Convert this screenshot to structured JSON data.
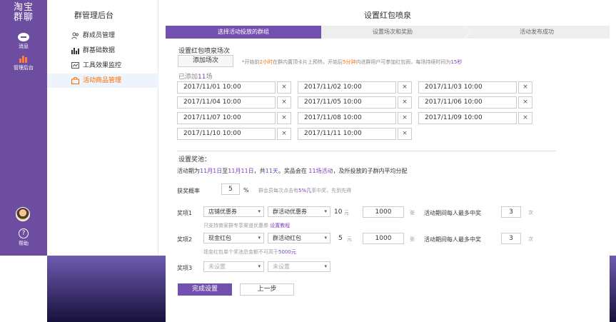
{
  "rail": {
    "logo_line1": "淘宝",
    "logo_line2": "群聊",
    "items": [
      {
        "label": "消息",
        "icon": "message-icon"
      },
      {
        "label": "管理后台",
        "icon": "chart-icon"
      },
      {
        "label": "帮助",
        "icon": "help-icon"
      }
    ],
    "help_glyph": "?"
  },
  "sidebar": {
    "title": "群管理后台",
    "items": [
      {
        "label": "群成员管理",
        "icon": "members-icon"
      },
      {
        "label": "群基础数据",
        "icon": "bar-chart-icon"
      },
      {
        "label": "工具效果监控",
        "icon": "monitor-icon"
      },
      {
        "label": "活动商品管理",
        "icon": "bag-icon",
        "active": true
      }
    ]
  },
  "page": {
    "title": "设置红包喷泉"
  },
  "steps": [
    "选择活动投放的群组",
    "设置场次和奖励",
    "活动发布成功"
  ],
  "sessions": {
    "section_title": "设置红包喷泉场次",
    "add_button": "添加场次",
    "hint": {
      "p1": "*开始前",
      "v1": "2小时",
      "p2": "在群内置顶卡片上预热，开始后",
      "v2": "5分钟",
      "p3": "内进群用户可参加红包雨，每场持续时间为",
      "v3": "15秒"
    },
    "count_prefix": "已添加",
    "count_value": "11",
    "count_suffix": "场",
    "remove_glyph": "×",
    "list": [
      "2017/11/01 10:00",
      "2017/11/02 10:00",
      "2017/11/03 10:00",
      "2017/11/04 10:00",
      "2017/11/05 10:00",
      "2017/11/06 10:00",
      "2017/11/07 10:00",
      "2017/11/08 10:00",
      "2017/11/09 10:00",
      "2017/11/10 10:00",
      "2017/11/11 10:00"
    ]
  },
  "prize": {
    "section_title": "设置奖池：",
    "desc": {
      "p1": "活动期为",
      "v1": "11月1日",
      "p2": "至",
      "v2": "11月11日",
      "p3": "，共",
      "v3": "11天",
      "p4": "。奖品会在 ",
      "v4": "11场活动",
      "p5": "，及所投放的子群内平均分配"
    },
    "rate_label": "获奖概率",
    "rate_value": "5",
    "rate_unit": "%",
    "rate_hint_p1": "群会员每次点击有",
    "rate_hint_v": "5%几",
    "rate_hint_p2": "率中奖，先到先得",
    "items": [
      {
        "label": "奖项1",
        "type": "店铺优惠券",
        "sub": "群活动优惠券",
        "denom": "10",
        "denom_unit": "元",
        "qty": "1000",
        "qty_unit": "张",
        "limit_label": "活动期间每人最多中奖",
        "limit": "3",
        "limit_unit": "次",
        "note": "只支持商家群专享渠道优惠券",
        "note_link": "设置教程"
      },
      {
        "label": "奖项2",
        "type": "现金红包",
        "sub": "群活动红包",
        "denom": "5",
        "denom_unit": "元",
        "qty": "1000",
        "qty_unit": "张",
        "limit_label": "活动期间每人最多中奖",
        "limit": "3",
        "limit_unit": "次",
        "note_p1": "现金红包单个奖池总金额不可高于",
        "note_v": "5000元"
      },
      {
        "label": "奖项3",
        "type": "未设置",
        "sub": "未设置"
      }
    ],
    "caret": "▾"
  },
  "actions": {
    "submit": "完成设置",
    "back": "上一步"
  }
}
